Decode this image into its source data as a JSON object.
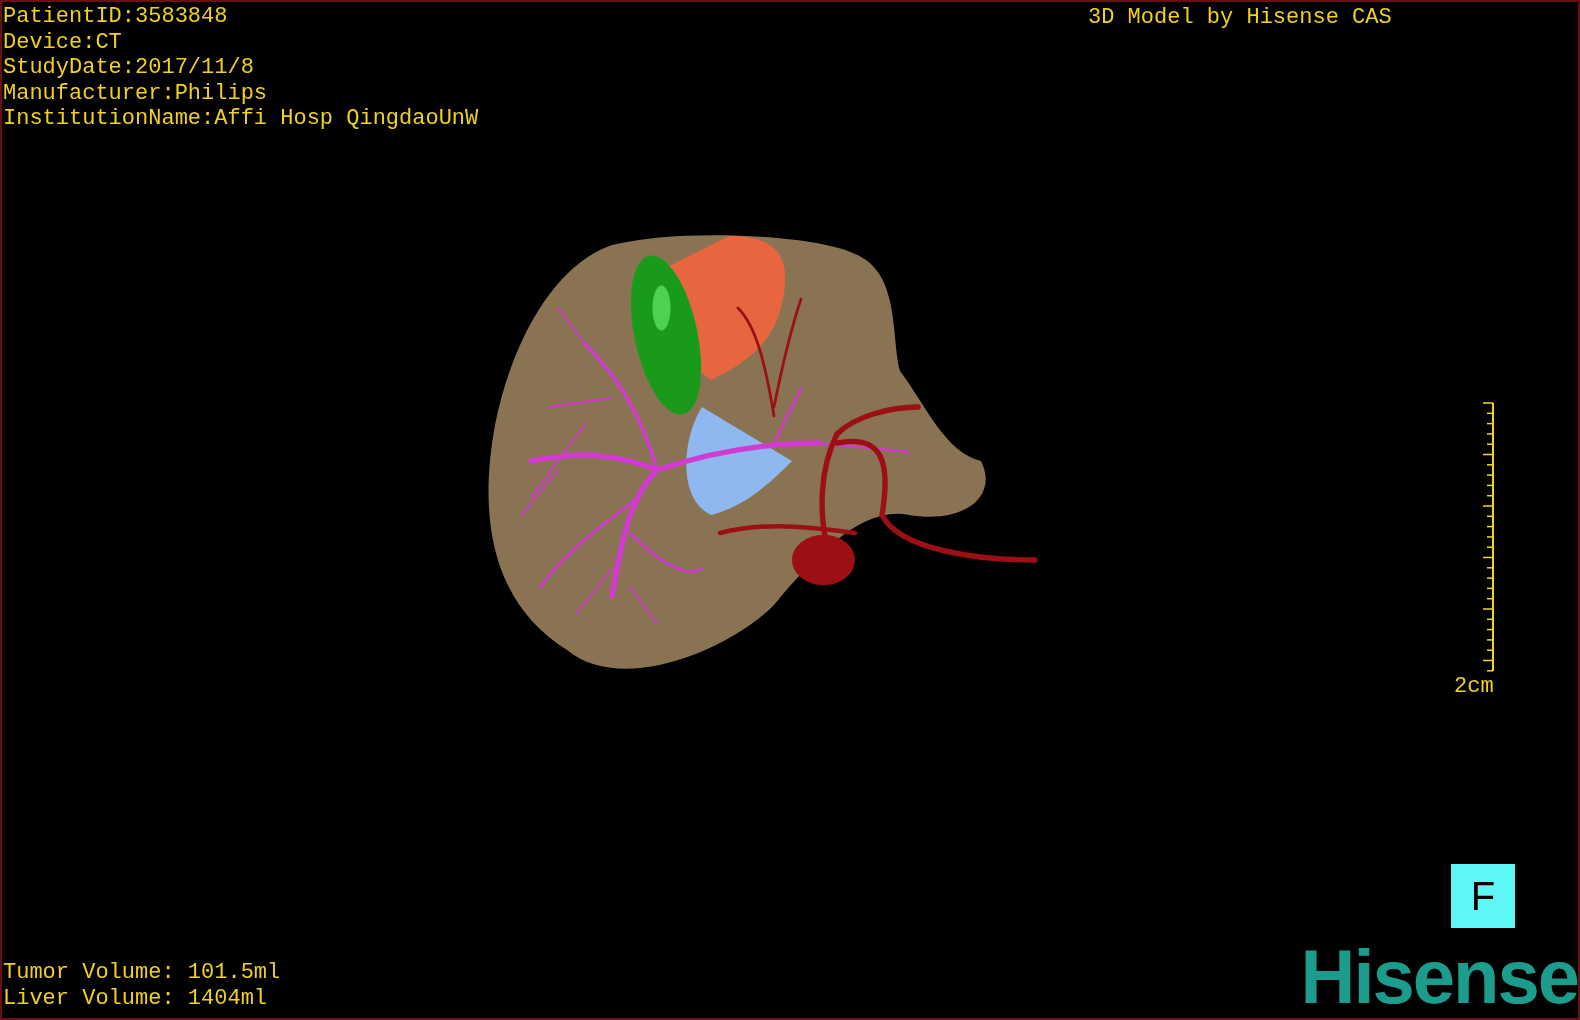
{
  "patient_info": [
    "PatientID:3583848",
    "Device:CT",
    "StudyDate:2017/11/8",
    "Manufacturer:Philips",
    "InstitutionName:Affi Hosp QingdaoUnW"
  ],
  "caption": "3D Model by Hisense CAS",
  "scale_bar": {
    "label": "2cm"
  },
  "orientation_marker": "F",
  "volumes": [
    "Tumor Volume: 101.5ml",
    "Liver Volume: 1404ml"
  ],
  "logo": "Hisense"
}
